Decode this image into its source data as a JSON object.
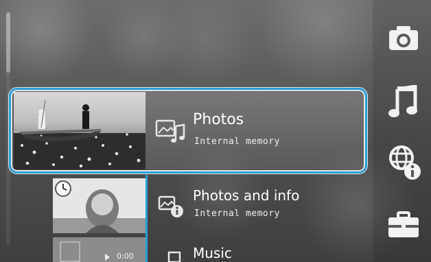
{
  "menu": {
    "items": [
      {
        "label": "Photos",
        "sub": "Internal memory"
      },
      {
        "label": "Photos and info",
        "sub": "Internal memory"
      },
      {
        "label": "Music",
        "sub": ""
      }
    ]
  },
  "thumbnails": {
    "video_time": "0:00"
  },
  "sidebar": {
    "icons": [
      "camera-icon",
      "music-note-icon",
      "globe-info-icon",
      "toolbox-icon"
    ]
  },
  "colors": {
    "accent": "#2aa0d8"
  }
}
